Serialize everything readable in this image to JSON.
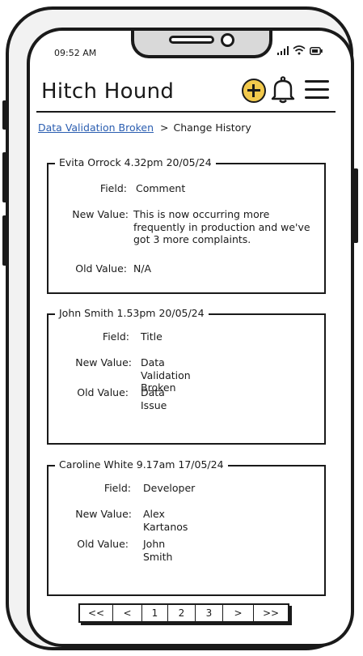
{
  "status": {
    "time": "09:52 AM"
  },
  "app": {
    "title": "Hitch Hound"
  },
  "breadcrumb": {
    "link": "Data Validation Broken",
    "separator": ">",
    "current": "Change History"
  },
  "labels": {
    "field": "Field:",
    "new_value": "New Value:",
    "old_value": "Old Value:"
  },
  "entries": [
    {
      "header": "Evita Orrock 4.32pm 20/05/24",
      "field": "Comment",
      "new_value": "This is now occurring more frequently in production and we've got 3 more complaints.",
      "old_value": "N/A"
    },
    {
      "header": "John Smith 1.53pm 20/05/24",
      "field": "Title",
      "new_value": "Data Validation Broken",
      "old_value": "Data Issue"
    },
    {
      "header": "Caroline White 9.17am 17/05/24",
      "field": "Developer",
      "new_value": "Alex Kartanos",
      "old_value": "John Smith"
    }
  ],
  "pagination": {
    "first": "<<",
    "prev": "<",
    "pages": [
      "1",
      "2",
      "3"
    ],
    "next": ">",
    "last": ">>"
  },
  "icons": {
    "add": "plus-circle-icon",
    "notifications": "bell-icon",
    "menu": "hamburger-menu-icon"
  },
  "colors": {
    "accent": "#f2c94c",
    "link": "#2a5db0"
  }
}
